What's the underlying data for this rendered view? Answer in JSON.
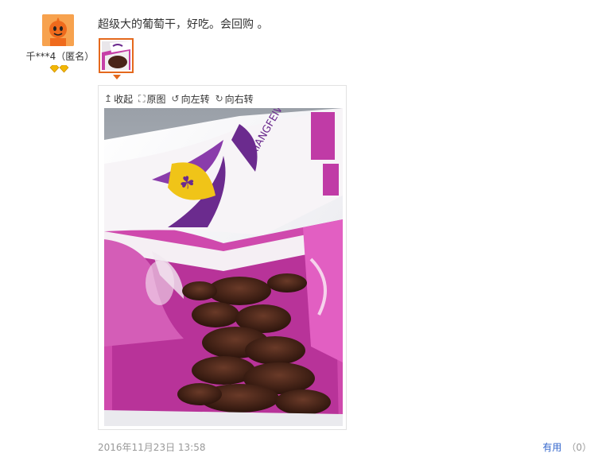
{
  "reviewer": {
    "name": "千***4（匿名）",
    "avatar_icon": "orange-mascot-icon",
    "rank_icons": [
      "gold-diamond-icon",
      "gold-diamond-icon"
    ]
  },
  "review": {
    "text": "超级大的葡萄干，好吃。会回购 。",
    "date": "2016年11月23日 13:58",
    "useful_label": "有用",
    "useful_count": "（0）"
  },
  "viewer": {
    "toolbar": [
      {
        "label": "收起",
        "icon": "collapse-arrow-icon"
      },
      {
        "label": "原图",
        "icon": "original-size-icon"
      },
      {
        "label": "向左转",
        "icon": "rotate-left-icon"
      },
      {
        "label": "向右转",
        "icon": "rotate-right-icon"
      }
    ],
    "photo_icon": "raisin-bag-photo",
    "package_text": "XIANGFEIWEI"
  },
  "colors": {
    "accent_orange": "#e4691d",
    "link_blue": "#3366cc",
    "package_purple": "#6b2b8e",
    "package_magenta": "#c03ba6"
  }
}
